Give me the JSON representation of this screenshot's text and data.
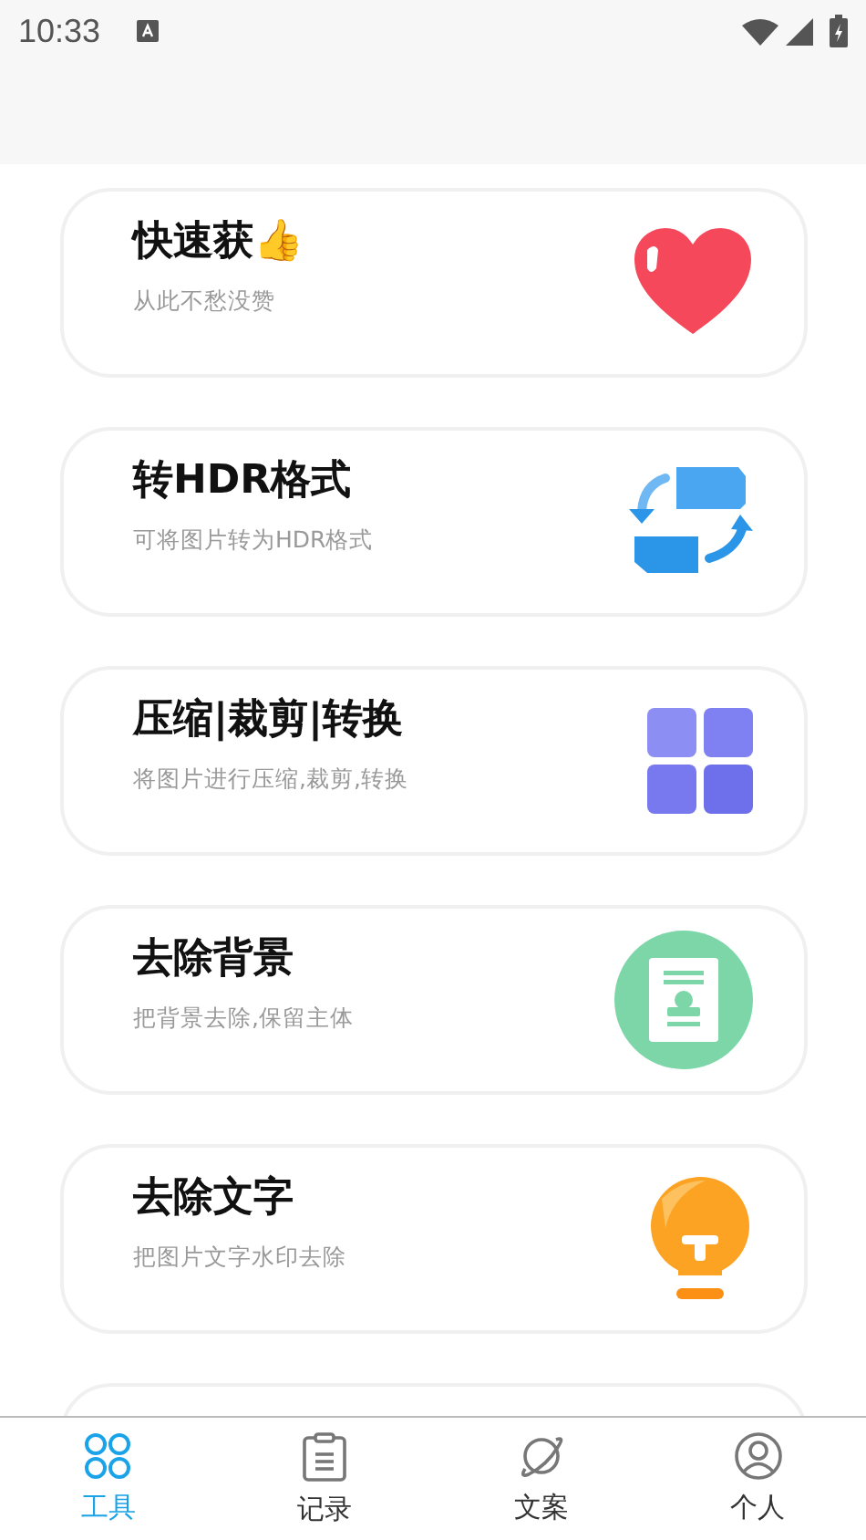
{
  "status_bar": {
    "time": "10:33"
  },
  "tools": [
    {
      "title": "快速获👍",
      "subtitle": "从此不愁没赞",
      "kind": "heart"
    },
    {
      "title": "转HDR格式",
      "subtitle": "可将图片转为HDR格式",
      "kind": "convert"
    },
    {
      "title": "压缩|裁剪|转换",
      "subtitle": "将图片进行压缩,裁剪,转换",
      "kind": "grid"
    },
    {
      "title": "去除背景",
      "subtitle": "把背景去除,保留主体",
      "kind": "portrait"
    },
    {
      "title": "去除文字",
      "subtitle": "把图片文字水印去除",
      "kind": "bulb"
    },
    {
      "kind": "partial"
    }
  ],
  "tab_bar": [
    {
      "label": "工具",
      "selected": true,
      "kind": "tools"
    },
    {
      "label": "记录",
      "selected": false,
      "kind": "record"
    },
    {
      "label": "文案",
      "selected": false,
      "kind": "planet"
    },
    {
      "label": "个人",
      "selected": false,
      "kind": "person"
    }
  ]
}
